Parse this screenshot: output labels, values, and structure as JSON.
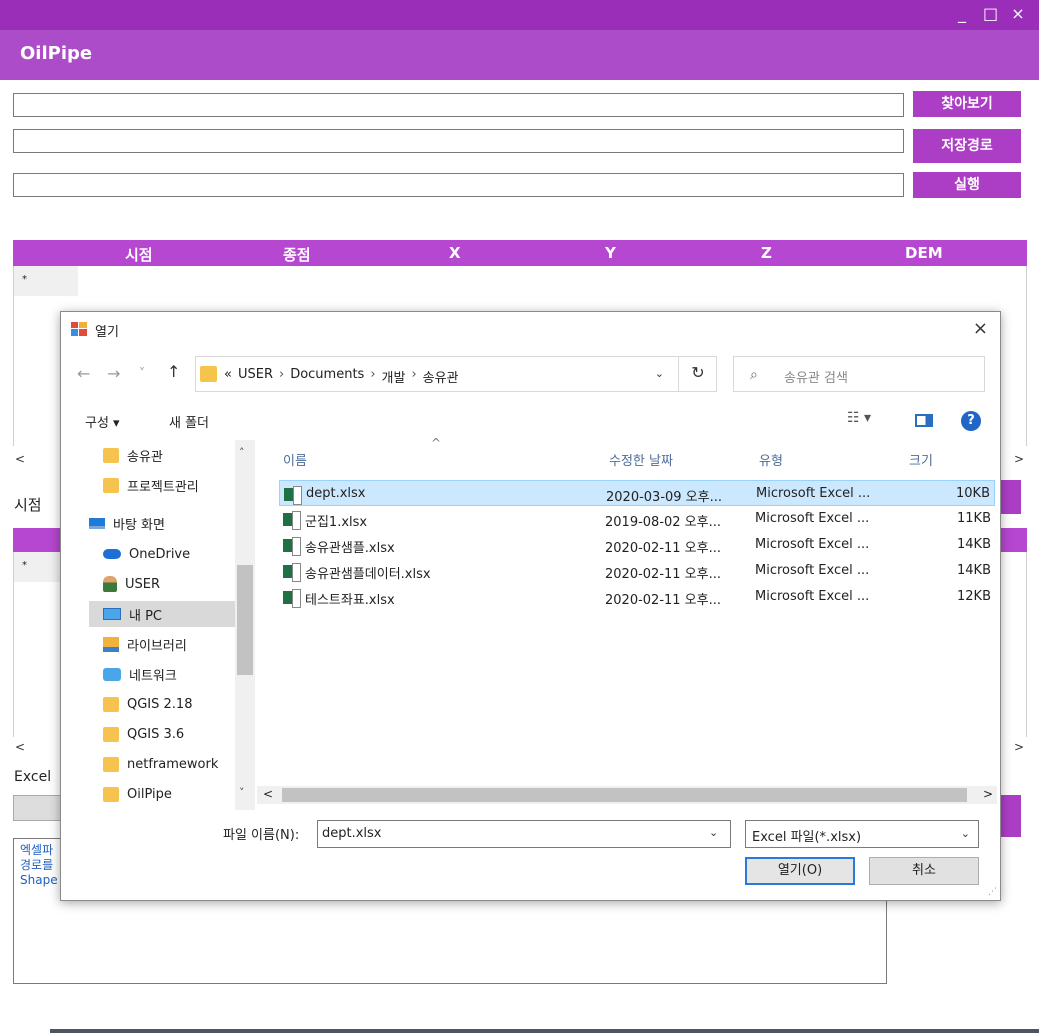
{
  "app": {
    "title": "OilPipe",
    "window_controls": {
      "minimize": "_",
      "maximize": "□",
      "close": "×"
    },
    "buttons": {
      "browse": "찾아보기",
      "save_path": "저장경로",
      "run": "실행"
    },
    "grid1": {
      "columns": [
        "시점",
        "종점",
        "X",
        "Y",
        "Z",
        "DEM"
      ],
      "new_row_marker": "*"
    },
    "grid2": {
      "new_row_marker": "*"
    },
    "labels": {
      "start_point": "시점",
      "excel": "Excel"
    },
    "log_lines": [
      "엑셀파",
      "경로를",
      "Shape"
    ],
    "scroll": {
      "left": "<",
      "right": ">"
    }
  },
  "dialog": {
    "title": "열기",
    "close": "×",
    "nav": {
      "back": "←",
      "forward": "→",
      "recent": "˅",
      "up": "↑"
    },
    "address": {
      "overflow": "«",
      "segments": [
        "USER",
        "Documents",
        "개발",
        "송유관"
      ],
      "separator": "›",
      "dropdown": "⌄",
      "refresh": "↻"
    },
    "search_placeholder": "송유관 검색",
    "toolbar": {
      "organize": "구성 ▾",
      "new_folder": "새 폴더"
    },
    "nav_pane": [
      {
        "label": "송유관",
        "icon": "folder"
      },
      {
        "label": "프로젝트관리",
        "icon": "folder"
      },
      {
        "label": "바탕 화면",
        "icon": "desktop"
      },
      {
        "label": "OneDrive",
        "icon": "cloud"
      },
      {
        "label": "USER",
        "icon": "user"
      },
      {
        "label": "내 PC",
        "icon": "pc"
      },
      {
        "label": "라이브러리",
        "icon": "library"
      },
      {
        "label": "네트워크",
        "icon": "network"
      },
      {
        "label": "QGIS 2.18",
        "icon": "folder"
      },
      {
        "label": "QGIS 3.6",
        "icon": "folder"
      },
      {
        "label": "netframework",
        "icon": "folder"
      },
      {
        "label": "OilPipe",
        "icon": "folder"
      }
    ],
    "columns": {
      "name": "이름",
      "date": "수정한 날짜",
      "type": "유형",
      "size": "크기"
    },
    "files": [
      {
        "name": "dept.xlsx",
        "date": "2020-03-09 오후...",
        "type": "Microsoft Excel ...",
        "size": "10KB"
      },
      {
        "name": "군집1.xlsx",
        "date": "2019-08-02 오후...",
        "type": "Microsoft Excel ...",
        "size": "11KB"
      },
      {
        "name": "송유관샘플.xlsx",
        "date": "2020-02-11 오후...",
        "type": "Microsoft Excel ...",
        "size": "14KB"
      },
      {
        "name": "송유관샘플데이터.xlsx",
        "date": "2020-02-11 오후...",
        "type": "Microsoft Excel ...",
        "size": "14KB"
      },
      {
        "name": "테스트좌표.xlsx",
        "date": "2020-02-11 오후...",
        "type": "Microsoft Excel ...",
        "size": "12KB"
      }
    ],
    "filename_label": "파일 이름(N):",
    "filename_value": "dept.xlsx",
    "filetype_value": "Excel 파일(*.xlsx)",
    "open_label": "열기(O)",
    "cancel_label": "취소"
  },
  "colors": {
    "titlebar": "#9a2eb9",
    "header": "#ac4cc8",
    "accent": "#ac3ec6",
    "selection": "#cce8ff"
  }
}
